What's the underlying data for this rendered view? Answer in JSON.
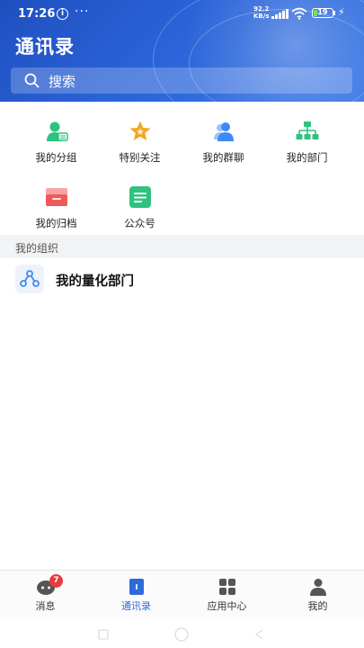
{
  "status": {
    "time": "17:26",
    "speed_value": "92.2",
    "speed_unit": "KB/s",
    "battery": "19"
  },
  "header": {
    "title": "通讯录",
    "search_placeholder": "搜索"
  },
  "grid": {
    "items": [
      {
        "label": "我的分组",
        "icon": "group-icon",
        "color": "#2ec27e"
      },
      {
        "label": "特别关注",
        "icon": "star-icon",
        "color": "#f5a623"
      },
      {
        "label": "我的群聊",
        "icon": "group-chat-icon",
        "color": "#3d8af7"
      },
      {
        "label": "我的部门",
        "icon": "department-icon",
        "color": "#2ec27e"
      },
      {
        "label": "我的归档",
        "icon": "archive-icon",
        "color": "#f05a5a"
      },
      {
        "label": "公众号",
        "icon": "official-account-icon",
        "color": "#2ec27e"
      }
    ]
  },
  "section": {
    "title": "我的组织"
  },
  "org": {
    "label": "我的量化部门",
    "icon": "org-tree-icon"
  },
  "tabbar": {
    "tabs": [
      {
        "label": "消息",
        "icon": "message-icon",
        "badge": "7"
      },
      {
        "label": "通讯录",
        "icon": "contacts-icon",
        "active": true
      },
      {
        "label": "应用中心",
        "icon": "apps-icon"
      },
      {
        "label": "我的",
        "icon": "profile-icon"
      }
    ]
  },
  "colors": {
    "accent": "#2f6bd8",
    "header": "#2a63d8",
    "badge": "#e43d3d"
  }
}
